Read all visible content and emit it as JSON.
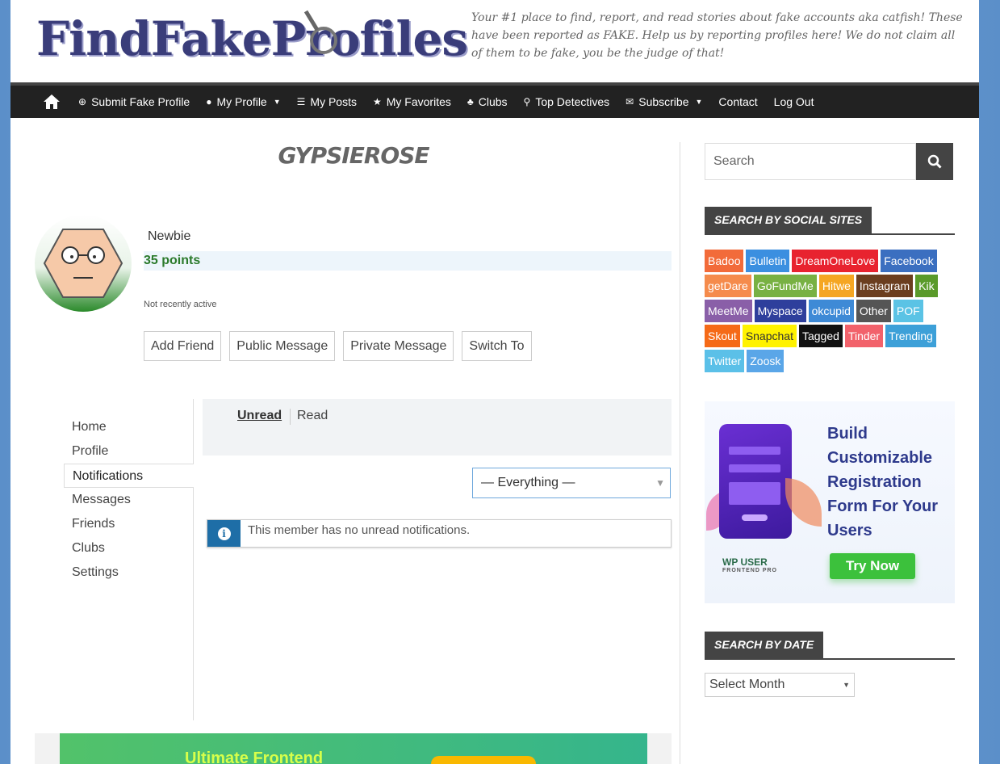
{
  "site": {
    "logo_text": "FindFakeProfiles",
    "tagline": "Your #1 place to find, report, and read stories about fake accounts aka catfish! These have been reported as FAKE. Help us by reporting profiles here! We do not claim all of them to be fake, you be the judge of that!"
  },
  "nav": {
    "home_icon": "home-icon",
    "items": [
      {
        "label": "Submit Fake Profile",
        "icon": "plus-circle-icon"
      },
      {
        "label": "My Profile",
        "icon": "user-icon",
        "has_caret": true
      },
      {
        "label": "My Posts",
        "icon": "list-icon"
      },
      {
        "label": "My Favorites",
        "icon": "star-icon"
      },
      {
        "label": "Clubs",
        "icon": "group-icon"
      },
      {
        "label": "Top Detectives",
        "icon": "search-icon"
      },
      {
        "label": "Subscribe",
        "icon": "mail-icon",
        "has_caret": true
      },
      {
        "label": "Contact"
      },
      {
        "label": "Log Out"
      }
    ]
  },
  "profile": {
    "name": "GypsieRose",
    "rank": "Newbie",
    "points": "35 points",
    "activity": "Not recently active",
    "actions": [
      "Add Friend",
      "Public Message",
      "Private Message",
      "Switch To"
    ]
  },
  "subnav": {
    "items": [
      "Home",
      "Profile",
      "Notifications",
      "Messages",
      "Friends",
      "Clubs",
      "Settings"
    ],
    "active": "Notifications"
  },
  "notifications": {
    "tab_unread": "Unread",
    "tab_read": "Read",
    "filter_value": "— Everything —",
    "empty_message": "This member has no unread notifications."
  },
  "bottom_banner": {
    "text": "Ultimate Frontend"
  },
  "sidebar": {
    "search_placeholder": "Search",
    "social_title": "Search by Social Sites",
    "tags": [
      {
        "label": "Badoo",
        "color": "#f26b3a"
      },
      {
        "label": "Bulletin",
        "color": "#3b8fe0"
      },
      {
        "label": "DreamOneLove",
        "color": "#e8232f"
      },
      {
        "label": "Facebook",
        "color": "#3b6fc0"
      },
      {
        "label": "getDare",
        "color": "#f58b4c"
      },
      {
        "label": "GoFundMe",
        "color": "#78b143"
      },
      {
        "label": "Hitwe",
        "color": "#f5a623"
      },
      {
        "label": "Instagram",
        "color": "#6b3e1f"
      },
      {
        "label": "Kik",
        "color": "#5a9a2a"
      },
      {
        "label": "MeetMe",
        "color": "#8a5fa8"
      },
      {
        "label": "Myspace",
        "color": "#2e3f9c"
      },
      {
        "label": "okcupid",
        "color": "#3e8ad6"
      },
      {
        "label": "Other",
        "color": "#555555"
      },
      {
        "label": "POF",
        "color": "#5bc3e5"
      },
      {
        "label": "Skout",
        "color": "#f56a18"
      },
      {
        "label": "Snapchat",
        "color": "#fff200"
      },
      {
        "label": "Tagged",
        "color": "#111111"
      },
      {
        "label": "Tinder",
        "color": "#f2626b"
      },
      {
        "label": "Trending",
        "color": "#3da0d8"
      },
      {
        "label": "Twitter",
        "color": "#5bc0e8"
      },
      {
        "label": "Zoosk",
        "color": "#5aa6e8"
      }
    ],
    "ad": {
      "headline": "Build Customizable Registration Form For Your Users",
      "button": "Try Now",
      "brand": "WP USER",
      "brand_sub": "FRONTEND PRO"
    },
    "date_title": "Search by Date",
    "month_select": "Select Month"
  }
}
